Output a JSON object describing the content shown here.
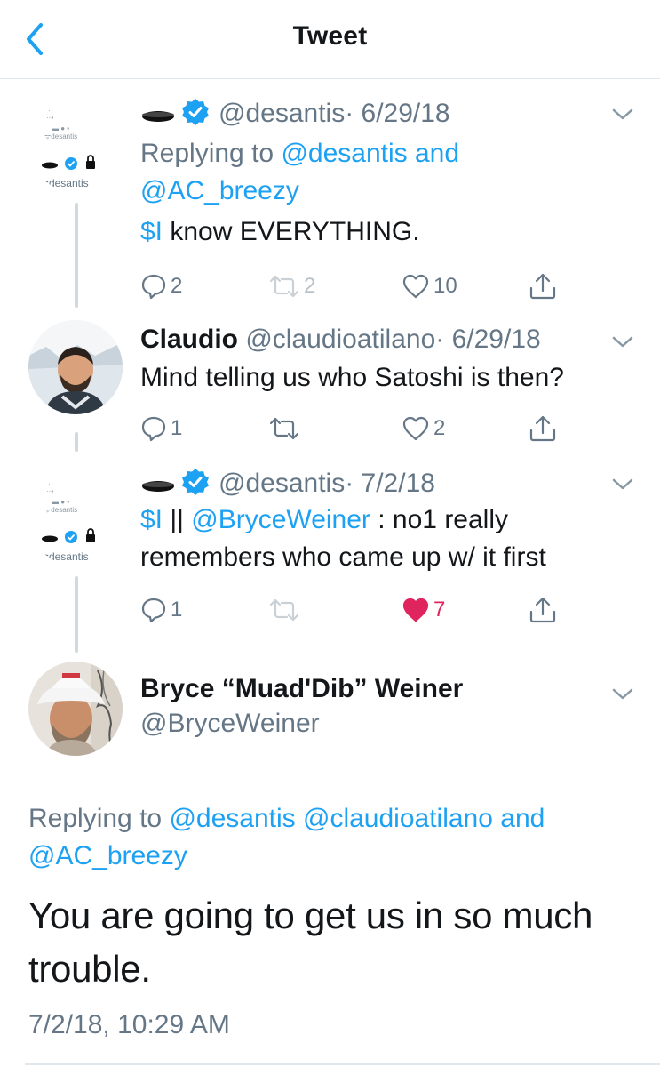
{
  "header": {
    "title": "Tweet",
    "back_icon": "back-arrow-icon"
  },
  "colors": {
    "accent": "#1da1f2",
    "like": "#e0245e",
    "muted": "#657786",
    "text": "#14171a"
  },
  "tweets": [
    {
      "avatar_handle": "ᯤdesantis",
      "name": "",
      "verified": true,
      "handle": "@desantis",
      "date": "· 6/29/18",
      "replying_prefix": "Replying to ",
      "replying_mention_1": "@desantis",
      "replying_and": " and",
      "replying_mention_2": "@AC_breezy",
      "text_cashtag": "$I",
      "text_rest": " know EVERYTHING.",
      "replies": "2",
      "retweets": "2",
      "likes": "10"
    },
    {
      "name": "Claudio",
      "handle": "@claudioatilano",
      "date": "· 6/29/18",
      "text": "Mind telling us who Satoshi is then?",
      "replies": "1",
      "retweets": "",
      "likes": "2"
    },
    {
      "avatar_handle": "ᯤdesantis",
      "name": "",
      "verified": true,
      "handle": "@desantis",
      "date": "· 7/2/18",
      "text_cashtag": "$I",
      "text_sep": " || ",
      "text_mention": "@BryceWeiner",
      "text_line1_rest": " : no1 really",
      "text_line2": "remembers who came up w/ it first",
      "replies": "1",
      "retweets": "",
      "likes": "7",
      "liked": true
    }
  ],
  "main_tweet": {
    "name": "Bryce “Muad'Dib” Weiner",
    "handle": "@BryceWeiner",
    "replying_prefix": "Replying to ",
    "replying_mention_1": "@desantis",
    "replying_mention_2": "@claudioatilano",
    "replying_and": " and",
    "replying_mention_3": "@AC_breezy",
    "text": "You are going to get us in so much trouble.",
    "timestamp": "7/2/18, 10:29 AM"
  }
}
